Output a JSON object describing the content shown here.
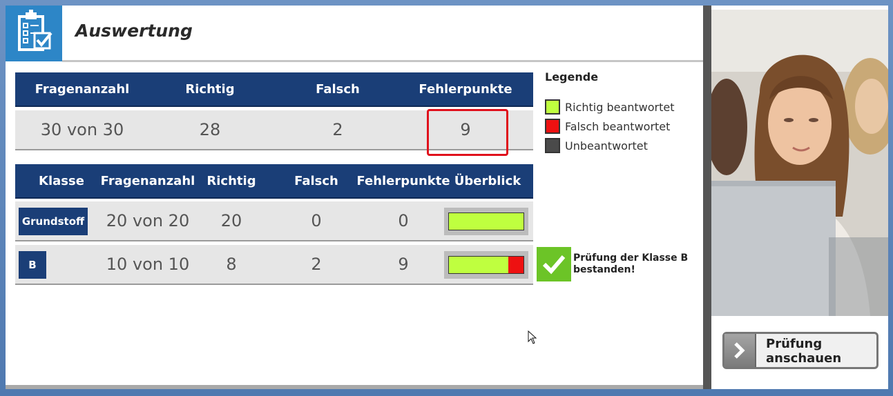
{
  "header": {
    "title": "Auswertung",
    "icon": "clipboard-checklist-icon"
  },
  "summary": {
    "columns": [
      "Fragenanzahl",
      "Richtig",
      "Falsch",
      "Fehlerpunkte"
    ],
    "values": {
      "questions": "30 von 30",
      "correct": "28",
      "wrong": "2",
      "error_points": "9"
    },
    "highlight_color": "#e0111c"
  },
  "class_table": {
    "columns": [
      "Klasse",
      "Fragenanzahl",
      "Richtig",
      "Falsch",
      "Fehlerpunkte",
      "Überblick"
    ],
    "rows": [
      {
        "class": "Grundstoff",
        "questions": "20 von 20",
        "correct": "20",
        "wrong": "0",
        "error_points": "0",
        "overview": {
          "correct_fraction": 1.0,
          "wrong_fraction": 0.0
        }
      },
      {
        "class": "B",
        "questions": "10 von 10",
        "correct": "8",
        "wrong": "2",
        "error_points": "9",
        "overview": {
          "correct_fraction": 0.8,
          "wrong_fraction": 0.2
        }
      }
    ]
  },
  "legend": {
    "title": "Legende",
    "items": [
      {
        "label": "Richtig beantwortet",
        "color": "#bfff3f"
      },
      {
        "label": "Falsch beantwortet",
        "color": "#ee1111"
      },
      {
        "label": "Unbeantwortet",
        "color": "#4a4a4a"
      }
    ]
  },
  "result": {
    "icon": "checkmark-icon",
    "message": "Prüfung der Klasse B bestanden!",
    "color": "#6cc427"
  },
  "review_button": {
    "label": "Prüfung anschauen",
    "icon": "chevron-right-icon"
  },
  "colors": {
    "table_header": "#1a3e77",
    "header_icon_bg": "#2d86c7"
  }
}
